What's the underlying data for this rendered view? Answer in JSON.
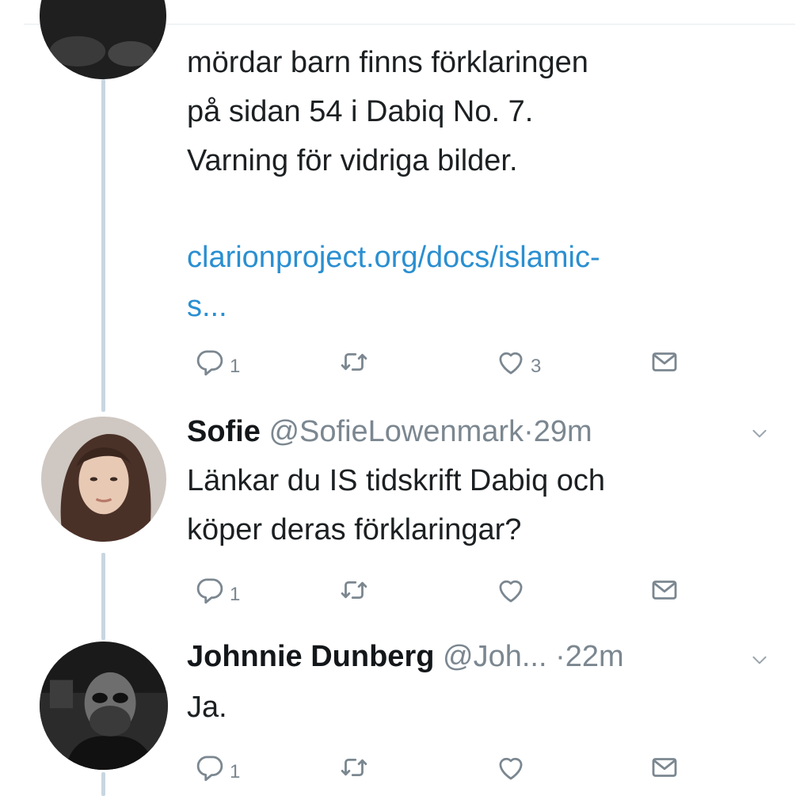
{
  "tweets": [
    {
      "text": "mördar barn finns förklaringen\npå sidan 54 i Dabiq No. 7.\nVarning för vidriga bilder.",
      "link_line1": "clarionproject.org/docs/islamic-",
      "link_line2": "s...",
      "reply_count": "1",
      "retweet_count": "",
      "like_count": "3"
    },
    {
      "name": "Sofie",
      "handle": "@SofieLowenmark",
      "time": "29m",
      "text": "Länkar du IS tidskrift Dabiq och\nköper deras förklaringar?",
      "reply_count": "1",
      "retweet_count": "",
      "like_count": ""
    },
    {
      "name": "Johnnie Dunberg",
      "handle": "@Joh...",
      "time": "22m",
      "text": "Ja.",
      "reply_count": "1",
      "retweet_count": "",
      "like_count": ""
    }
  ],
  "separator": "·",
  "icons": {
    "reply": "reply-icon",
    "retweet": "retweet-icon",
    "like": "heart-icon",
    "dm": "envelope-icon",
    "menu": "chevron-down-icon"
  },
  "colors": {
    "link": "#2a8fd1",
    "muted": "#7b8790",
    "thread_line": "#c9d6e1",
    "text": "#1c2022"
  }
}
